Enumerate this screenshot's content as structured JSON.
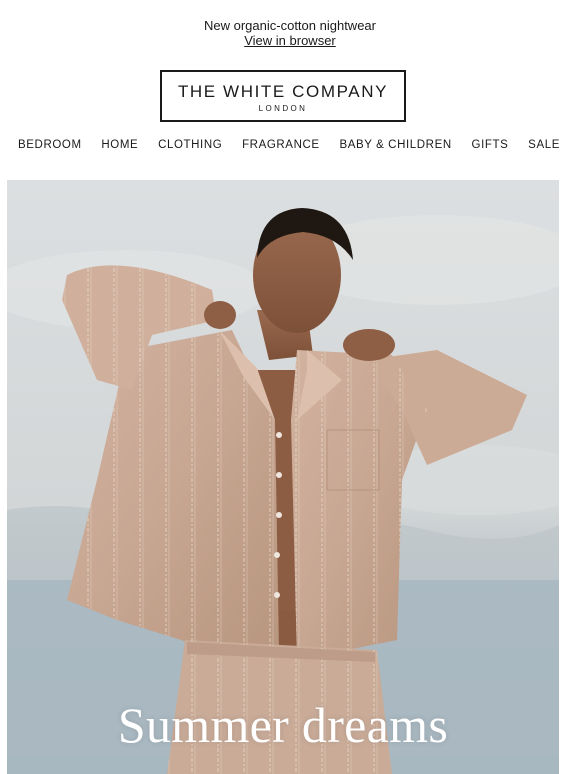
{
  "preheader": {
    "text": "New organic-cotton nightwear",
    "browser_link": "View in browser"
  },
  "logo": {
    "name": "THE WHITE COMPANY",
    "city": "LONDON"
  },
  "nav": {
    "items": [
      "BEDROOM",
      "HOME",
      "CLOTHING",
      "FRAGRANCE",
      "BABY & CHILDREN",
      "GIFTS",
      "SALE"
    ]
  },
  "hero": {
    "title": "Summer dreams",
    "image": "woman-in-striped-cotton-pyjamas-photo",
    "colors": {
      "sky": "#d6dadc",
      "sea": "#a9b7c0",
      "pyjama": "#c9a894",
      "skin": "#8a5a42"
    }
  }
}
